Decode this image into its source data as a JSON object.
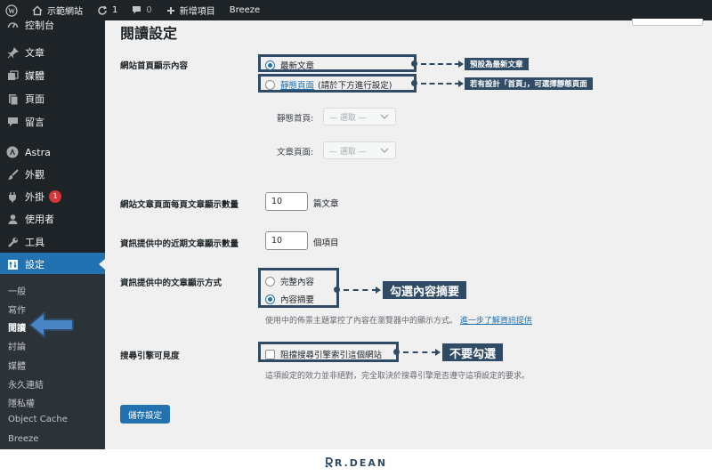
{
  "adminbar": {
    "site_name": "示範網站",
    "updates_count": "1",
    "comments_count": "0",
    "new_label": "新增項目",
    "plugin_label": "Breeze",
    "icons": [
      "wordpress-icon",
      "home-icon",
      "refresh-icon",
      "comment-icon",
      "plus-icon"
    ]
  },
  "sidebar": {
    "items": [
      {
        "label": "控制台",
        "icon": "dashboard-icon"
      },
      {
        "label": "文章",
        "icon": "pin-icon"
      },
      {
        "label": "媒體",
        "icon": "media-icon"
      },
      {
        "label": "頁面",
        "icon": "page-icon"
      },
      {
        "label": "留言",
        "icon": "comment-icon"
      },
      {
        "label": "Astra",
        "icon": "astra-icon"
      },
      {
        "label": "外觀",
        "icon": "brush-icon"
      },
      {
        "label": "外掛",
        "icon": "plug-icon",
        "badge": "1"
      },
      {
        "label": "使用者",
        "icon": "user-icon"
      },
      {
        "label": "工具",
        "icon": "wrench-icon"
      },
      {
        "label": "設定",
        "icon": "settings-icon"
      }
    ],
    "submenu": [
      "一般",
      "寫作",
      "閱讀",
      "討論",
      "媒體",
      "永久連結",
      "隱私權",
      "Object Cache",
      "Breeze"
    ]
  },
  "page": {
    "title": "閱讀設定",
    "homepage": {
      "label": "網站首頁顯示內容",
      "option_latest": "最新文章",
      "option_static_link": "靜態頁面",
      "option_static_note": "(請於下方進行設定)",
      "callout_latest": "預設為最新文章",
      "callout_static": "若有設計「首頁」，可選擇靜態頁面",
      "static_home_label": "靜態首頁:",
      "posts_page_label": "文章頁面:",
      "select_placeholder": "— 選取 —"
    },
    "posts_per_page": {
      "label": "網站文章頁面每頁文章顯示數量",
      "value": "10",
      "suffix": "篇文章"
    },
    "feed_count": {
      "label": "資訊提供中的近期文章顯示數量",
      "value": "10",
      "suffix": "個項目"
    },
    "feed_display": {
      "label": "資訊提供中的文章顯示方式",
      "option_full": "完整內容",
      "option_excerpt": "內容摘要",
      "callout": "勾選內容摘要",
      "desc": "使用中的佈景主題掌控了內容在瀏覽器中的顯示方式。",
      "desc_link": "進一步了解資訊提供"
    },
    "search_visibility": {
      "label": "搜尋引擎可見度",
      "checkbox_label": "阻擋搜尋引擎索引這個網站",
      "callout": "不要勾選",
      "desc": "這項設定的效力並非絕對，完全取決於搜尋引擎是否遵守這項設定的要求。"
    },
    "save_button": "儲存設定"
  },
  "footer": {
    "brand": "R.DEAN"
  },
  "colors": {
    "accent": "#2271b1",
    "annotation": "#2f4b66",
    "sidebar": "#1d2327",
    "submenu": "#2c3338"
  }
}
